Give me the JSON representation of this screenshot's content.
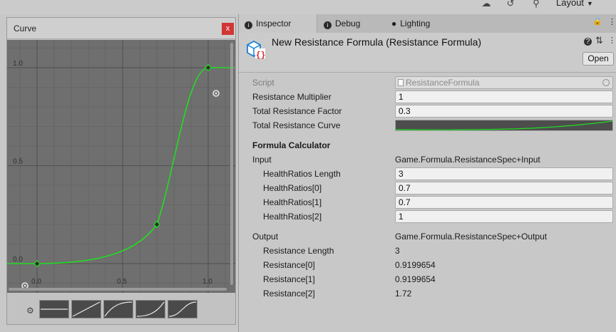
{
  "toolbar": {
    "account_icon": "cloud-account-icon",
    "history_icon": "history-icon",
    "search_icon": "search-icon",
    "layout_label": "Layout"
  },
  "curve_window": {
    "title": "Curve",
    "close_label": "x",
    "x_ticks": [
      "0.0",
      "0.5",
      "1.0"
    ],
    "y_ticks": [
      "1.0",
      "0.5",
      "0.0"
    ],
    "curve_color": "#22dd22",
    "keys": [
      {
        "time": 0.0,
        "value": 0.0
      },
      {
        "time": 0.7,
        "value": 0.2
      },
      {
        "time": 1.0,
        "value": 1.0
      }
    ],
    "presets": [
      "flat",
      "linear",
      "ease-out",
      "ease-in",
      "ease-in-out"
    ]
  },
  "tabs": {
    "inspector": "Inspector",
    "debug": "Debug",
    "lighting": "Lighting"
  },
  "header": {
    "title": "New Resistance Formula (Resistance Formula)",
    "open_label": "Open"
  },
  "fields": {
    "script_label": "Script",
    "script_value": "ResistanceFormula",
    "multiplier_label": "Resistance Multiplier",
    "multiplier_value": "1",
    "factor_label": "Total Resistance Factor",
    "factor_value": "0.3",
    "curve_label": "Total Resistance Curve"
  },
  "calculator": {
    "heading": "Formula Calculator",
    "input_label": "Input",
    "input_type": "Game.Formula.ResistanceSpec+Input",
    "health_length_label": "HealthRatios Length",
    "health_length_value": "3",
    "health_ratios": [
      {
        "label": "HealthRatios[0]",
        "value": "0.7"
      },
      {
        "label": "HealthRatios[1]",
        "value": "0.7"
      },
      {
        "label": "HealthRatios[2]",
        "value": "1"
      }
    ],
    "output_label": "Output",
    "output_type": "Game.Formula.ResistanceSpec+Output",
    "resistance_length_label": "Resistance Length",
    "resistance_length_value": "3",
    "resistances": [
      {
        "label": "Resistance[0]",
        "value": "0.9199654"
      },
      {
        "label": "Resistance[1]",
        "value": "0.9199654"
      },
      {
        "label": "Resistance[2]",
        "value": "1.72"
      }
    ]
  },
  "colors": {
    "curve_green": "#22dd22",
    "close_red": "#d13636",
    "script_icon_blue": "#1a7fd6",
    "script_icon_red": "#d32020"
  }
}
